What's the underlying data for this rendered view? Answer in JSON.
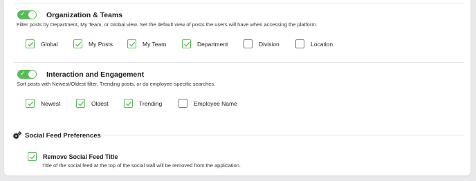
{
  "org": {
    "title": "Organization & Teams",
    "description": "Filter posts by Department, My Team, or Global view. Set the default view of posts the users will have when accessing the platform.",
    "options": [
      {
        "label": "Global",
        "checked": true
      },
      {
        "label": "My Posts",
        "checked": true
      },
      {
        "label": "My Team",
        "checked": true
      },
      {
        "label": "Department",
        "checked": true
      },
      {
        "label": "Division",
        "checked": false
      },
      {
        "label": "Location",
        "checked": false
      }
    ]
  },
  "interaction": {
    "title": "Interaction and Engagement",
    "description": "Sort posts with Newest/Oldest filter, Trending posts, or do employee-specific searches.",
    "options": [
      {
        "label": "Newest",
        "checked": true
      },
      {
        "label": "Oldest",
        "checked": true
      },
      {
        "label": "Trending",
        "checked": true
      },
      {
        "label": "Employee Name",
        "checked": false
      }
    ]
  },
  "social": {
    "title": "Social Feed Preferences",
    "remove_title": {
      "label": "Remove Social Feed Title",
      "description": "Title of the social feed at the top of the social wall will be removed from the application.",
      "checked": true
    }
  },
  "icons": {
    "toggle": "toggle-on-icon",
    "check": "check-icon",
    "settings": "gears-icon"
  },
  "colors": {
    "accent": "#5cb85c",
    "unchecked_border": "#7a7a7a",
    "background": "#e9e9eb"
  }
}
